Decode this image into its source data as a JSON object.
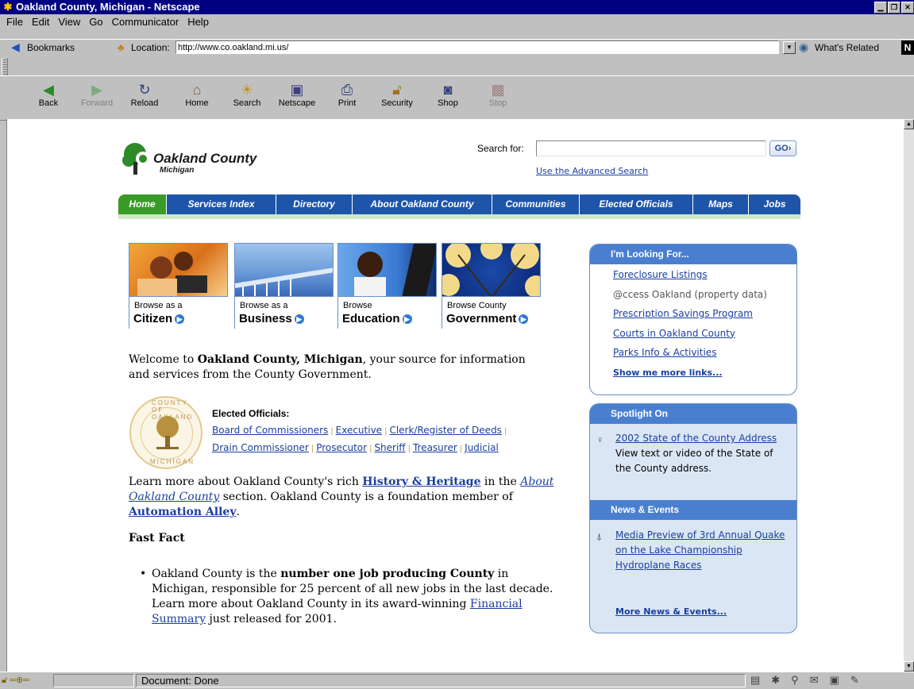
{
  "window": {
    "title": "Oakland County, Michigan - Netscape"
  },
  "menu": [
    "File",
    "Edit",
    "View",
    "Go",
    "Communicator",
    "Help"
  ],
  "location_bar": {
    "bookmarks_label": "Bookmarks",
    "location_label": "Location:",
    "url": "http://www.co.oakland.mi.us/",
    "related_label": "What's Related"
  },
  "toolbar": [
    {
      "label": "Back",
      "icon": "back-arrow-icon",
      "enabled": true
    },
    {
      "label": "Forward",
      "icon": "forward-arrow-icon",
      "enabled": false
    },
    {
      "label": "Reload",
      "icon": "reload-icon",
      "enabled": true
    },
    {
      "label": "Home",
      "icon": "home-icon",
      "enabled": true
    },
    {
      "label": "Search",
      "icon": "search-icon",
      "enabled": true
    },
    {
      "label": "Netscape",
      "icon": "netscape-icon",
      "enabled": true
    },
    {
      "label": "Print",
      "icon": "print-icon",
      "enabled": true
    },
    {
      "label": "Security",
      "icon": "lock-icon",
      "enabled": true
    },
    {
      "label": "Shop",
      "icon": "shop-icon",
      "enabled": true
    },
    {
      "label": "Stop",
      "icon": "stop-icon",
      "enabled": false
    }
  ],
  "page": {
    "logo": {
      "name": "Oakland County",
      "sub": "Michigan"
    },
    "search": {
      "label": "Search for:",
      "button": "GO",
      "advanced": "Use the Advanced Search"
    },
    "nav_tabs": [
      "Home",
      "Services Index",
      "Directory",
      "About Oakland County",
      "Communities",
      "Elected Officials",
      "Maps",
      "Jobs"
    ],
    "browse": [
      {
        "small": "Browse as a",
        "big": "Citizen"
      },
      {
        "small": "Browse as a",
        "big": "Business"
      },
      {
        "small": "Browse",
        "big": "Education"
      },
      {
        "small": "Browse County",
        "big": "Government"
      }
    ],
    "welcome": {
      "pre": "Welcome to ",
      "bold": "Oakland County, Michigan",
      "post": ", your source for information and services from the County Government."
    },
    "seal": {
      "top": "COUNTY OF OAKLAND",
      "bottom": "MICHIGAN",
      "mark": "SEAL"
    },
    "elected_officials": {
      "title": "Elected Officials:",
      "links": [
        "Board of Commissioners",
        "Executive",
        "Clerk/Register of Deeds",
        "Drain Commissioner",
        "Prosecutor",
        "Sheriff",
        "Treasurer",
        "Judicial"
      ]
    },
    "learn": {
      "t1": "Learn more about Oakland County's rich ",
      "link1": "History & Heritage",
      "t2": " in the ",
      "link2": "About Oakland County",
      "t3": " section. Oakland County is a foundation member of ",
      "link3": "Automation Alley",
      "t4": "."
    },
    "fast_fact": {
      "heading": "Fast Fact",
      "t1": "Oakland County is the ",
      "bold": "number one job producing County",
      "t2": " in Michigan, responsible for 25 percent of all new jobs in the last decade. Learn more about Oakland County in its award-winning ",
      "link": "Financial Summary",
      "t3": " just released for 2001."
    },
    "looking_for": {
      "title": "I'm Looking For...",
      "links": [
        "Foreclosure Listings",
        "@ccess Oakland (property data)",
        "Prescription Savings Program",
        "Courts in Oakland County",
        "Parks Info & Activities"
      ],
      "more": "Show me more links..."
    },
    "spotlight": {
      "title": "Spotlight On",
      "link": "2002 State of the County Address",
      "text": "View text or video of the State of the County address."
    },
    "news": {
      "title": "News & Events",
      "link": "Media Preview of 3rd Annual Quake on the Lake Championship Hydroplane Races",
      "more": "More News & Events..."
    }
  },
  "status": {
    "message": "Document: Done"
  },
  "colors": {
    "tab_blue": "#1f55a8",
    "tab_green": "#3a9a28",
    "panel_blue": "#4a7fd0",
    "link": "#1a3fa0"
  }
}
